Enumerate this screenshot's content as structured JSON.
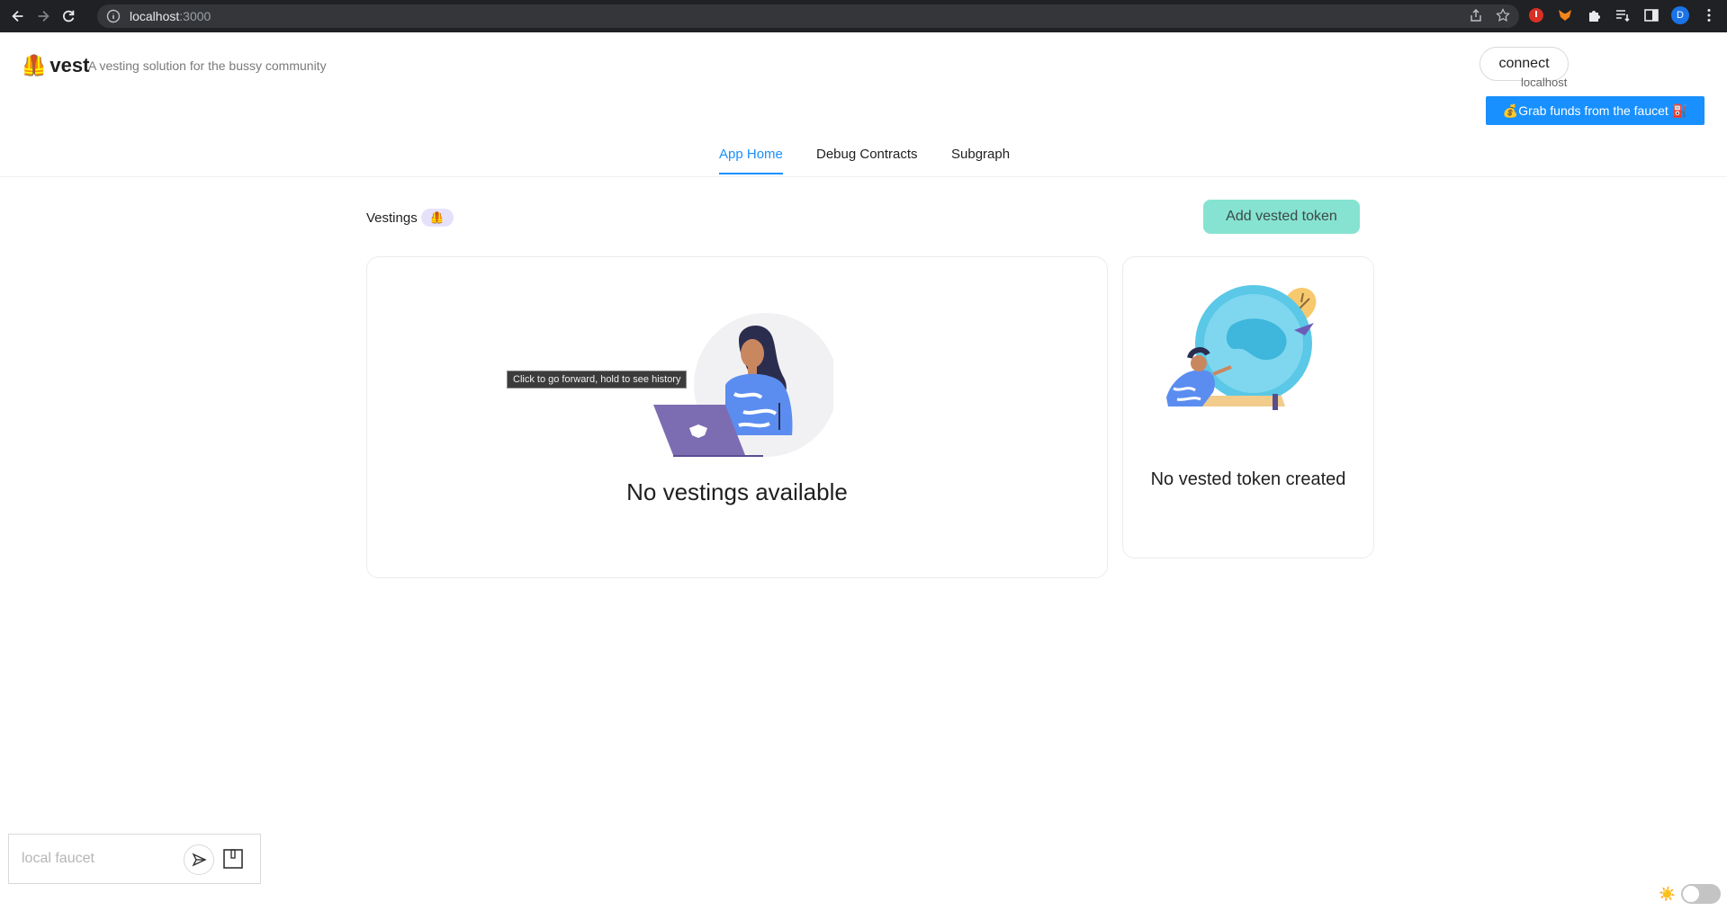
{
  "browser": {
    "url_host": "localhost",
    "url_port": ":3000",
    "profile_initial": "D"
  },
  "header": {
    "logo_emoji": "🦺",
    "app_name": "vest",
    "tagline": "A vesting solution for the bussy community",
    "connect_label": "connect",
    "network_label": "localhost",
    "faucet_label": "💰Grab funds from the faucet ⛽"
  },
  "tabs": [
    {
      "label": "App Home",
      "active": true
    },
    {
      "label": "Debug Contracts",
      "active": false
    },
    {
      "label": "Subgraph",
      "active": false
    }
  ],
  "vestings": {
    "title": "Vestings",
    "badge": "🦺",
    "add_button": "Add vested token",
    "empty_main": "No vestings available",
    "empty_side": "No vested token created"
  },
  "tooltip": "Click to go forward, hold to see history",
  "footer": {
    "faucet_placeholder": "local faucet",
    "theme_icon": "☀️"
  },
  "colors": {
    "primary": "#1890ff",
    "accent_button": "#86e3d1",
    "badge_bg": "#e6e1fb"
  }
}
